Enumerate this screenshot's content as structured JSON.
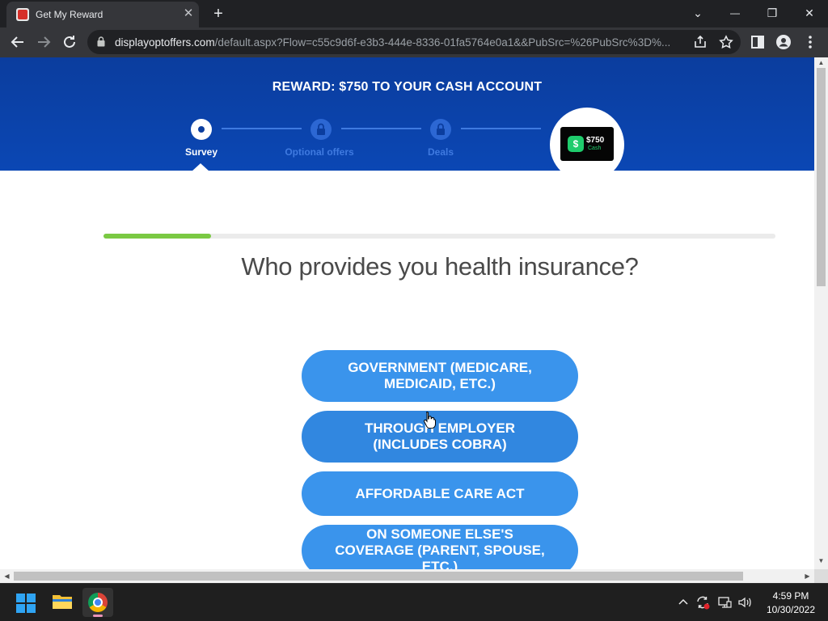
{
  "browser": {
    "tab_title": "Get My Reward",
    "tab_close": "✕",
    "new_tab": "+",
    "url_domain": "displayoptoffers.com",
    "url_rest": "/default.aspx?Flow=c55c9d6f-e3b3-444e-8336-01fa5764e0a1&&PubSrc=%26PubSrc%3D%...",
    "window_controls": {
      "tab_search": "⌄",
      "minimize": "—",
      "restore": "❐",
      "close": "✕"
    },
    "toolbar_icons": {
      "back": "back-arrow-icon",
      "forward": "forward-arrow-icon",
      "reload": "reload-icon",
      "share": "share-icon",
      "bookmark": "star-icon",
      "sidepanel": "side-panel-icon",
      "profile": "profile-icon",
      "menu": "kebab-menu-icon"
    }
  },
  "hero": {
    "title": "REWARD: $750 TO YOUR CASH ACCOUNT",
    "steps": [
      {
        "label": "Survey",
        "state": "active",
        "color": "#ffffff"
      },
      {
        "label": "Optional offers",
        "state": "locked",
        "color": "#3f7ae0"
      },
      {
        "label": "Deals",
        "state": "locked",
        "color": "#3f7ae0"
      }
    ],
    "reward_card": {
      "icon": "$",
      "amount": "$750",
      "sub": "Cash"
    }
  },
  "survey": {
    "progress_fraction": 0.16,
    "question": "Who provides you health insurance?",
    "answers": [
      "GOVERNMENT (MEDICARE, MEDICAID, ETC.)",
      "THROUGH EMPLOYER (INCLUDES COBRA)",
      "AFFORDABLE CARE ACT",
      "ON SOMEONE ELSE'S COVERAGE (PARENT, SPOUSE, ETC.)"
    ]
  },
  "taskbar": {
    "time": "4:59 PM",
    "date": "10/30/2022",
    "tray_icons": [
      "chevron-up-icon",
      "sync-icon",
      "display-icon",
      "volume-icon"
    ]
  },
  "colors": {
    "hero_blue": "#0b3d9e",
    "answer_blue": "#3a94ec",
    "progress_green": "#7ac943",
    "cash_green": "#1fcc6c"
  }
}
